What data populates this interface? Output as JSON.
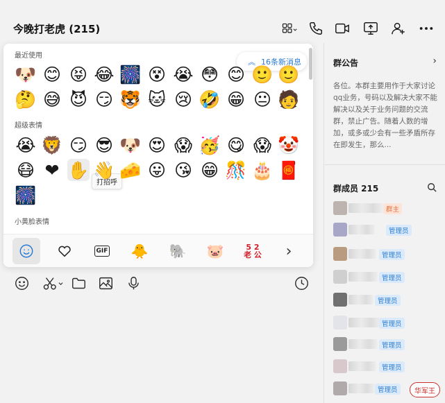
{
  "header": {
    "title": "今晚打老虎 (215)",
    "icons": [
      "apps-icon",
      "phone-icon",
      "video-call-icon",
      "screen-share-icon",
      "add-member-icon",
      "more-icon"
    ]
  },
  "sticker_panel": {
    "new_messages_label": "16条新消息",
    "tooltip": "打招呼",
    "sections": [
      {
        "label": "最近使用",
        "rows": [
          [
            "🐶",
            "😊",
            "😝",
            "😂",
            "🎆",
            "😵",
            "😭",
            "😳",
            "😊",
            "🙂",
            "🙂",
            "🙏"
          ],
          [
            "🤔",
            "😅",
            "😈",
            "😏",
            "🐯",
            "🐱",
            "😢",
            "🤣",
            "😁",
            "😐",
            "🧑",
            "😅"
          ]
        ]
      },
      {
        "label": "超级表情",
        "rows": [
          [
            "😭",
            "🦁",
            "😏",
            "😎",
            "🐶",
            "😍",
            "😱",
            "🥳",
            "😋",
            "😱",
            "🤡"
          ],
          [
            "😷",
            "❤",
            "✋",
            "👋",
            "🧀",
            "😛",
            "😘",
            "😁",
            "🎊",
            "🎂",
            "🧧"
          ],
          [
            "🎆"
          ]
        ]
      },
      {
        "label": "小黄脸表情",
        "rows": []
      }
    ],
    "tabs": [
      {
        "name": "emoji",
        "glyph": "☺"
      },
      {
        "name": "favorites",
        "glyph": "♡"
      },
      {
        "name": "gif",
        "glyph": "GIF"
      },
      {
        "name": "sticker-pack-1",
        "glyph": "🐥"
      },
      {
        "name": "sticker-pack-2",
        "glyph": "🐘"
      },
      {
        "name": "sticker-pack-3",
        "glyph": "🐷"
      },
      {
        "name": "sticker-pack-4",
        "glyph": "5 2\n老 公"
      },
      {
        "name": "next",
        "glyph": "›"
      }
    ]
  },
  "toolbar": {
    "icons": [
      "emoji-icon",
      "scissors-icon",
      "folder-icon",
      "image-icon",
      "microphone-icon",
      "clock-icon"
    ]
  },
  "sidebar": {
    "notice_title": "群公告",
    "notice_text": "各位。本群主要用作于大家讨论qq业务，号码以及解决大家不能解决以及关于业务问题的交流群，禁止广告。随着人数的增加，或多或少会有一些矛盾所存在即发生，那么...",
    "members_title": "群成员 215",
    "members": [
      {
        "role": "群主",
        "role_type": "owner",
        "avatar_color": "#bdb4b0"
      },
      {
        "role": "管理员",
        "role_type": "admin",
        "avatar_color": "#a8a7c8"
      },
      {
        "role": "管理员",
        "role_type": "admin",
        "avatar_color": "#b99b80"
      },
      {
        "role": "管理员",
        "role_type": "admin",
        "avatar_color": "#cfcfcf"
      },
      {
        "role": "管理员",
        "role_type": "admin",
        "avatar_color": "#707070"
      },
      {
        "role": "管理员",
        "role_type": "admin",
        "avatar_color": "#e3e3ea"
      },
      {
        "role": "管理员",
        "role_type": "admin",
        "avatar_color": "#9a9a9a"
      },
      {
        "role": "管理员",
        "role_type": "admin",
        "avatar_color": "#d8c8cc"
      },
      {
        "role": "管理员",
        "role_type": "admin",
        "avatar_color": "#b0aaaa"
      }
    ]
  },
  "watermark": "华军王",
  "colors": {
    "accent_blue": "#2b7bd3",
    "owner_badge": "#e2713a",
    "background": "#f2f2f2"
  }
}
